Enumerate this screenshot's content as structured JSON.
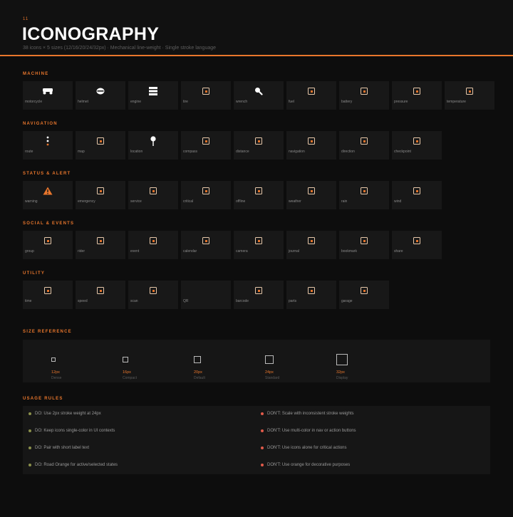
{
  "header": {
    "number": "11",
    "title": "ICONOGRAPHY",
    "subtitle": "38 icons × 5 sizes (12/16/20/24/32px) · Mechanical line-weight · Single stroke language"
  },
  "colors": {
    "accent": "#e8762c",
    "do": "#8a8f4a",
    "dont": "#e05a4a"
  },
  "categories": [
    {
      "title": "MACHINE",
      "items": [
        {
          "label": "motorcycle",
          "icon": "motorcycle-icon"
        },
        {
          "label": "helmet",
          "icon": "helmet-icon"
        },
        {
          "label": "engine",
          "icon": "engine-icon"
        },
        {
          "label": "tire",
          "icon": "placeholder-icon"
        },
        {
          "label": "wrench",
          "icon": "wrench-icon"
        },
        {
          "label": "fuel",
          "icon": "placeholder-icon"
        },
        {
          "label": "battery",
          "icon": "placeholder-icon"
        },
        {
          "label": "pressure",
          "icon": "placeholder-icon"
        },
        {
          "label": "temperature",
          "icon": "placeholder-icon"
        }
      ]
    },
    {
      "title": "NAVIGATION",
      "items": [
        {
          "label": "route",
          "icon": "route-icon"
        },
        {
          "label": "map",
          "icon": "placeholder-icon"
        },
        {
          "label": "location",
          "icon": "location-icon"
        },
        {
          "label": "compass",
          "icon": "placeholder-icon"
        },
        {
          "label": "distance",
          "icon": "placeholder-icon"
        },
        {
          "label": "navigation",
          "icon": "placeholder-icon"
        },
        {
          "label": "direction",
          "icon": "placeholder-icon"
        },
        {
          "label": "checkpoint",
          "icon": "placeholder-icon"
        }
      ]
    },
    {
      "title": "STATUS & ALERT",
      "items": [
        {
          "label": "warning",
          "icon": "warning-icon"
        },
        {
          "label": "emergency",
          "icon": "placeholder-icon"
        },
        {
          "label": "service",
          "icon": "placeholder-icon"
        },
        {
          "label": "critical",
          "icon": "placeholder-icon"
        },
        {
          "label": "offline",
          "icon": "placeholder-icon"
        },
        {
          "label": "weather",
          "icon": "placeholder-icon"
        },
        {
          "label": "rain",
          "icon": "placeholder-icon"
        },
        {
          "label": "wind",
          "icon": "placeholder-icon"
        }
      ]
    },
    {
      "title": "SOCIAL & EVENTS",
      "items": [
        {
          "label": "group",
          "icon": "placeholder-icon"
        },
        {
          "label": "rider",
          "icon": "placeholder-icon"
        },
        {
          "label": "event",
          "icon": "placeholder-icon"
        },
        {
          "label": "calendar",
          "icon": "placeholder-icon"
        },
        {
          "label": "camera",
          "icon": "placeholder-icon"
        },
        {
          "label": "journal",
          "icon": "placeholder-icon"
        },
        {
          "label": "bookmark",
          "icon": "placeholder-icon"
        },
        {
          "label": "share",
          "icon": "placeholder-icon"
        }
      ]
    },
    {
      "title": "UTILITY",
      "items": [
        {
          "label": "time",
          "icon": "placeholder-icon"
        },
        {
          "label": "speed",
          "icon": "placeholder-icon"
        },
        {
          "label": "scan",
          "icon": "placeholder-icon"
        },
        {
          "label": "QR",
          "icon": "none"
        },
        {
          "label": "barcode",
          "icon": "placeholder-icon"
        },
        {
          "label": "parts",
          "icon": "placeholder-icon"
        },
        {
          "label": "garage",
          "icon": "placeholder-icon"
        }
      ]
    }
  ],
  "size_reference": {
    "title": "SIZE REFERENCE",
    "sizes": [
      {
        "px": "12px",
        "name": "Dense"
      },
      {
        "px": "16px",
        "name": "Compact"
      },
      {
        "px": "20px",
        "name": "Default"
      },
      {
        "px": "24px",
        "name": "Standard"
      },
      {
        "px": "32px",
        "name": "Display"
      }
    ]
  },
  "usage_rules": {
    "title": "USAGE RULES",
    "do": [
      "DO: Use 2px stroke weight at 24px",
      "DO: Keep icons single-color in UI contexts",
      "DO: Pair with short label text",
      "DO: Road Orange for active/selected states"
    ],
    "dont": [
      "DON'T: Scale with inconsistent stroke weights",
      "DON'T: Use multi-color in nav or action buttons",
      "DON'T: Use icons alone for critical actions",
      "DON'T: Use orange for decorative purposes"
    ]
  }
}
